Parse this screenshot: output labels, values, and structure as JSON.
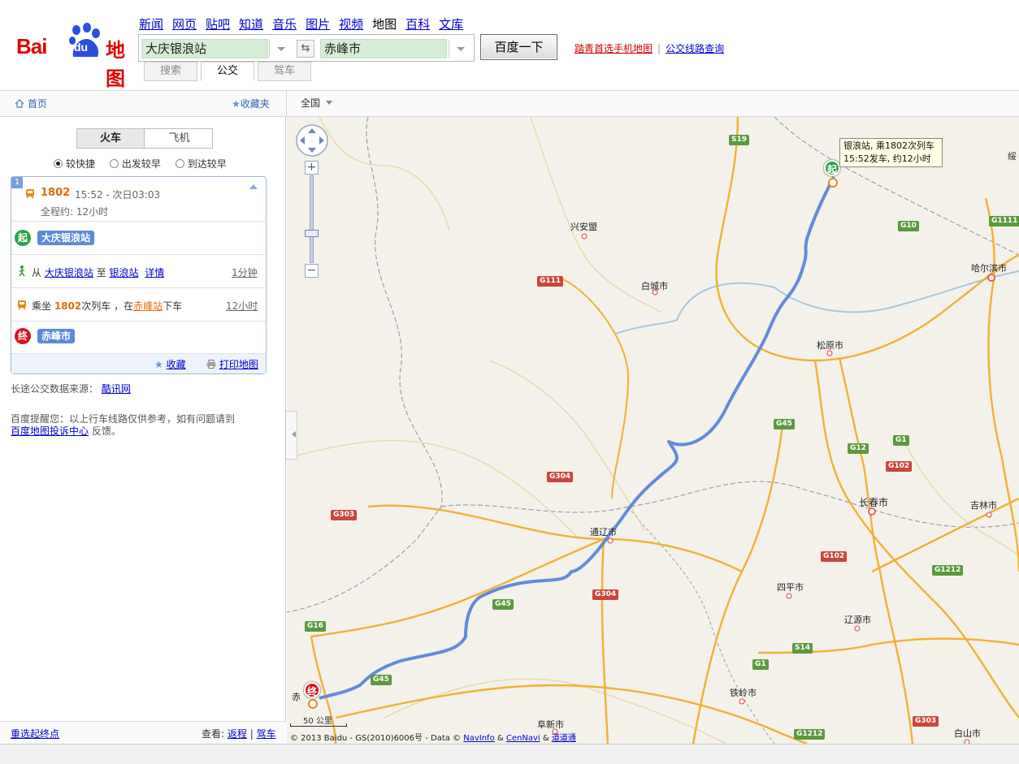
{
  "header": {
    "logo_left": "Bai",
    "logo_paw": "du",
    "logo_right": "地图",
    "nav": [
      "新闻",
      "网页",
      "贴吧",
      "知道",
      "音乐",
      "图片",
      "视频",
      "地图",
      "百科",
      "文库"
    ],
    "from_value": "大庆银浪站",
    "to_value": "赤峰市",
    "swap_glyph": "⇆",
    "search_button": "百度一下",
    "link_mobile": "踏青首选手机地图",
    "link_sep": "|",
    "link_bus": "公交线路查询",
    "modes": [
      "搜索",
      "公交",
      "驾车"
    ]
  },
  "toolbar": {
    "home": "首页",
    "favorites": "收藏夹",
    "region": "全国"
  },
  "left": {
    "tabs": [
      "火车",
      "飞机"
    ],
    "options": [
      "较快捷",
      "出发较早",
      "到达较早"
    ],
    "result": {
      "index": "1",
      "train_no": "1802",
      "time": "15:52 - 次日03:03",
      "duration": "全程约: 12小时",
      "start_pin": "起",
      "start_name": "大庆银浪站",
      "walk_from_label": "从",
      "walk_from": "大庆银浪站",
      "walk_to_label": "至",
      "walk_to": "银浪站",
      "walk_detail": "详情",
      "walk_time": "1分钟",
      "ride_prefix": "乘坐",
      "ride_train": "1802",
      "ride_mid": "次列车 ，在",
      "ride_station": "赤峰站",
      "ride_suffix": "下车",
      "ride_time": "12小时",
      "end_pin": "终",
      "end_name": "赤峰市",
      "favorite": "收藏",
      "print": "打印地图"
    },
    "source_label": "长途公交数据来源：",
    "source_link": "酷讯网",
    "notice_text": "百度提醒您：以上行车线路仅供参考，如有问题请到",
    "notice_link": "百度地图投诉中心",
    "notice_end": "反馈。",
    "footer_reset": "重选起终点",
    "footer_view": "查看:",
    "footer_return": "返程",
    "footer_sep": "|",
    "footer_drive": "驾车"
  },
  "map": {
    "popup_line1": "银浪站, 乘1802次列车",
    "popup_line2": "15:52发车, 约12小时",
    "start_pin": "起",
    "end_pin": "终",
    "cities": {
      "xinganmeng": "兴安盟",
      "baicheng": "白城市",
      "harbin": "哈尔滨市",
      "songyuan": "松原市",
      "changchun": "长春市",
      "jilin": "吉林市",
      "tongliao": "通辽市",
      "siping": "四平市",
      "liaoyuan": "辽源市",
      "tieling": "铁岭市",
      "fuxin": "阜新市",
      "baishan": "白山市",
      "chifeng": "赤",
      "sui": "绥"
    },
    "roads": {
      "s19": "S19",
      "g10": "G10",
      "g1111": "G1111",
      "g111": "G111",
      "g45a": "G45",
      "g12": "G12",
      "g1": "G1",
      "g102a": "G102",
      "g304a": "G304",
      "g303": "G303",
      "g102b": "G102",
      "g1212a": "G1212",
      "g45b": "G45",
      "g304b": "G304",
      "g16": "G16",
      "s14": "S14",
      "g1b": "G1",
      "g45c": "G45",
      "g1212b": "G1212",
      "g303b": "G303"
    },
    "scale": "50 公里",
    "copyright_text": "© 2013 Baidu - GS(2010)6006号 - Data ©",
    "copyright_navinfo": "NavInfo",
    "copyright_amp": "&",
    "copyright_cennavi": "CenNavi",
    "copyright_amp2": "&",
    "copyright_last": "道道通"
  },
  "colors": {
    "route": "#5b86d6",
    "expressway": "#f2b134",
    "brand_red": "#e10601",
    "start_green": "#2aa246",
    "end_red": "#d7141e"
  }
}
